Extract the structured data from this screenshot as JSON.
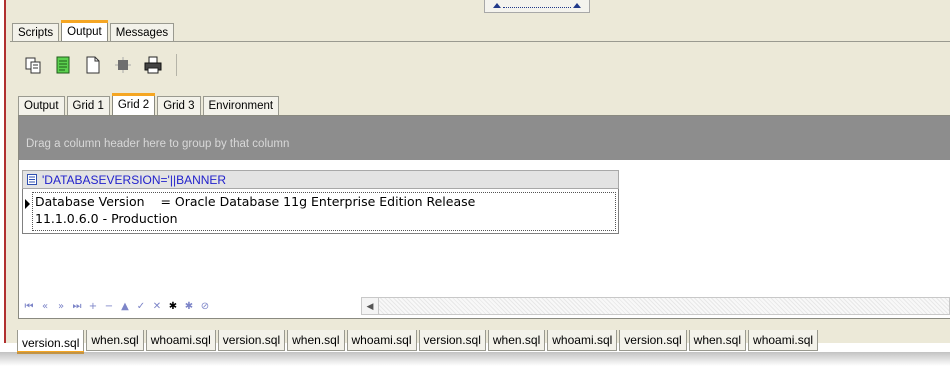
{
  "top_tabs": [
    {
      "label": "Scripts",
      "active": false
    },
    {
      "label": "Output",
      "active": true
    },
    {
      "label": "Messages",
      "active": false
    }
  ],
  "toolbar": {
    "icons": [
      "copy-icon",
      "notes-icon",
      "new-page-icon",
      "stop-icon",
      "print-icon"
    ]
  },
  "sub_tabs": [
    {
      "label": "Output",
      "active": false
    },
    {
      "label": "Grid 1",
      "active": false
    },
    {
      "label": "Grid 2",
      "active": true
    },
    {
      "label": "Grid 3",
      "active": false
    },
    {
      "label": "Environment",
      "active": false
    }
  ],
  "grid": {
    "group_hint": "Drag a column header here to group by that column",
    "column_header": "'DATABASEVERSION='||BANNER",
    "row_value": "Database Version    = Oracle Database 11g Enterprise Edition Release\n11.1.0.6.0 - Production"
  },
  "navigator": {
    "buttons": [
      {
        "glyph": "⏮",
        "name": "first-record-button"
      },
      {
        "glyph": "«",
        "name": "prior-page-button"
      },
      {
        "glyph": "»",
        "name": "next-page-button"
      },
      {
        "glyph": "⏭",
        "name": "last-record-button"
      },
      {
        "glyph": "+",
        "name": "insert-record-button"
      },
      {
        "glyph": "−",
        "name": "delete-record-button"
      },
      {
        "glyph": "▲",
        "name": "edit-record-button"
      },
      {
        "glyph": "✓",
        "name": "post-edit-button"
      },
      {
        "glyph": "✕",
        "name": "cancel-edit-button"
      },
      {
        "glyph": "✱",
        "name": "bookmark-button"
      },
      {
        "glyph": "✱",
        "name": "goto-bookmark-button"
      },
      {
        "glyph": "⊘",
        "name": "filter-button"
      }
    ]
  },
  "file_tabs": [
    {
      "label": "version.sql",
      "active": true
    },
    {
      "label": "when.sql",
      "active": false
    },
    {
      "label": "whoami.sql",
      "active": false
    },
    {
      "label": "version.sql",
      "active": false
    },
    {
      "label": "when.sql",
      "active": false
    },
    {
      "label": "whoami.sql",
      "active": false
    },
    {
      "label": "version.sql",
      "active": false
    },
    {
      "label": "when.sql",
      "active": false
    },
    {
      "label": "whoami.sql",
      "active": false
    },
    {
      "label": "version.sql",
      "active": false
    },
    {
      "label": "when.sql",
      "active": false
    },
    {
      "label": "whoami.sql",
      "active": false
    }
  ]
}
